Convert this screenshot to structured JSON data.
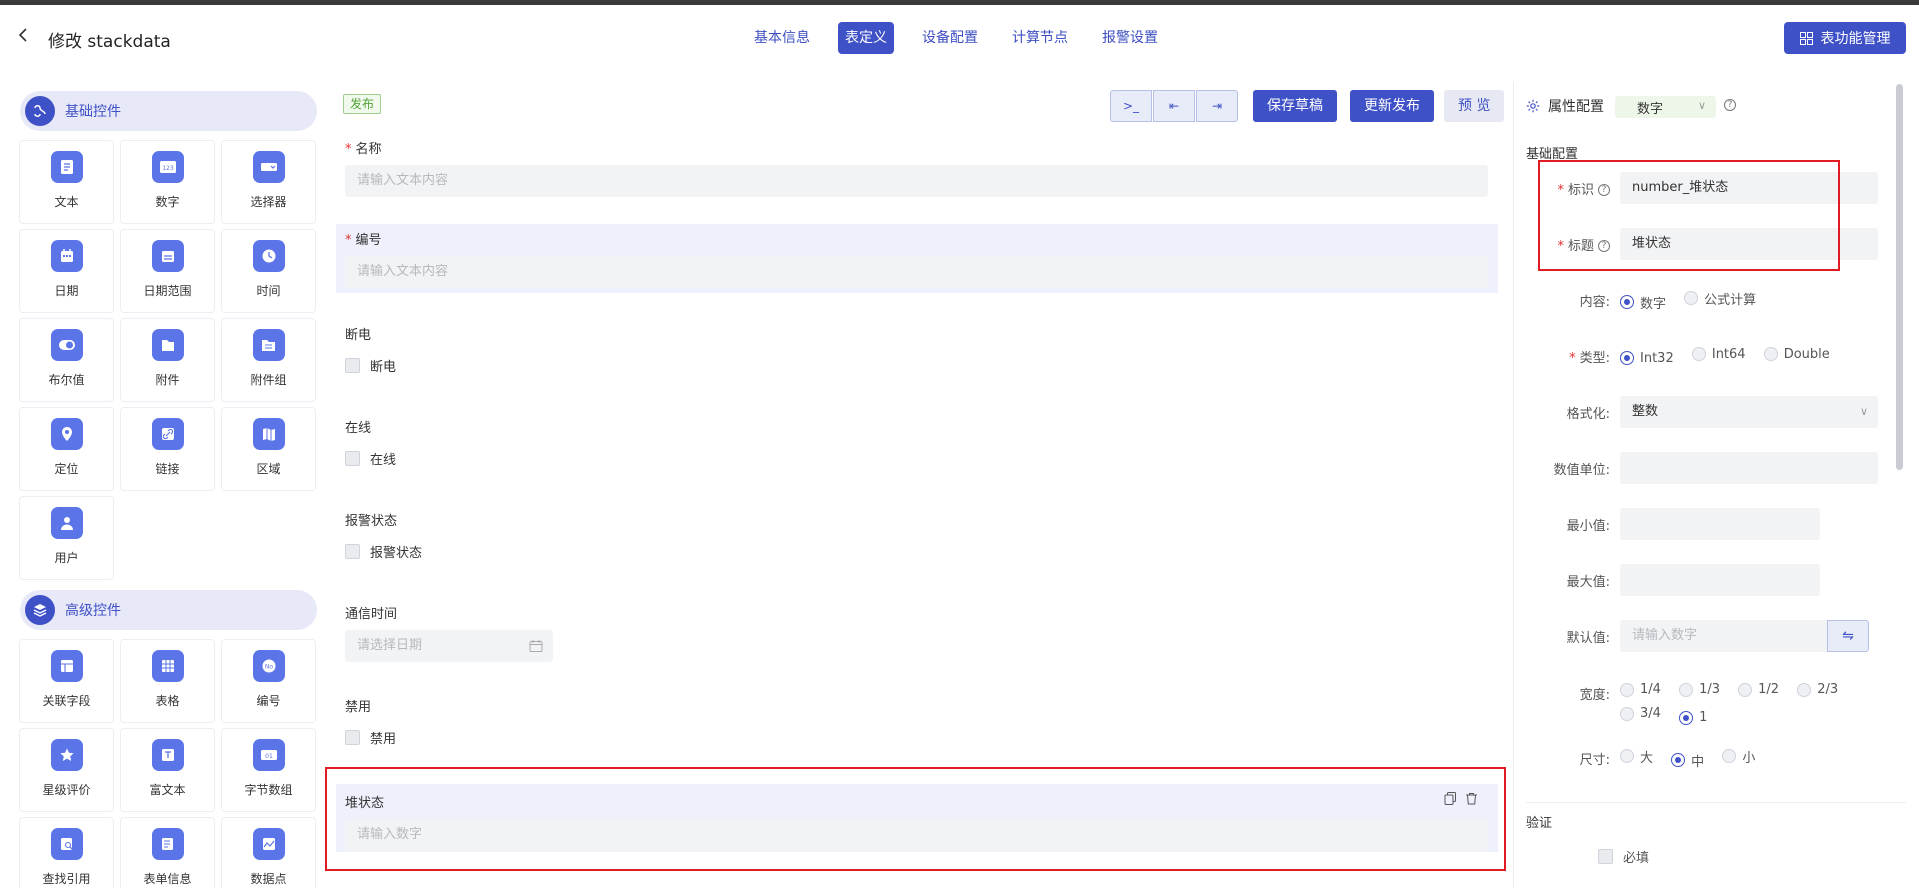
{
  "header": {
    "title": "修改 stackdata",
    "tabs": [
      {
        "label": "基本信息",
        "active": false
      },
      {
        "label": "表定义",
        "active": true
      },
      {
        "label": "设备配置",
        "active": false
      },
      {
        "label": "计算节点",
        "active": false
      },
      {
        "label": "报警设置",
        "active": false
      }
    ],
    "manage_button": "表功能管理"
  },
  "sidebar": {
    "basic_title": "基础控件",
    "basic_items": [
      {
        "label": "文本",
        "icon": "text-icon"
      },
      {
        "label": "数字",
        "icon": "number-icon"
      },
      {
        "label": "选择器",
        "icon": "select-icon"
      },
      {
        "label": "日期",
        "icon": "date-icon"
      },
      {
        "label": "日期范围",
        "icon": "date-range-icon"
      },
      {
        "label": "时间",
        "icon": "time-icon"
      },
      {
        "label": "布尔值",
        "icon": "boolean-icon"
      },
      {
        "label": "附件",
        "icon": "attachment-icon"
      },
      {
        "label": "附件组",
        "icon": "attachment-group-icon"
      },
      {
        "label": "定位",
        "icon": "location-icon"
      },
      {
        "label": "链接",
        "icon": "link-icon"
      },
      {
        "label": "区域",
        "icon": "area-icon"
      },
      {
        "label": "用户",
        "icon": "user-icon"
      }
    ],
    "advanced_title": "高级控件",
    "advanced_items": [
      {
        "label": "关联字段",
        "icon": "relation-field-icon"
      },
      {
        "label": "表格",
        "icon": "table-icon"
      },
      {
        "label": "编号",
        "icon": "serial-number-icon"
      },
      {
        "label": "星级评价",
        "icon": "star-rating-icon"
      },
      {
        "label": "富文本",
        "icon": "rich-text-icon"
      },
      {
        "label": "字节数组",
        "icon": "byte-array-icon"
      },
      {
        "label": "查找引用",
        "icon": "lookup-icon"
      },
      {
        "label": "表单信息",
        "icon": "form-info-icon"
      },
      {
        "label": "数据点",
        "icon": "data-point-icon"
      }
    ]
  },
  "form": {
    "status_badge": "发布",
    "toolbar_icons": [
      ">_",
      "⇤",
      "⇥"
    ],
    "save_draft": "保存草稿",
    "update_publish": "更新发布",
    "preview": "预 览",
    "name_label": "名称",
    "name_placeholder": "请输入文本内容",
    "code_label": "编号",
    "code_placeholder": "请输入文本内容",
    "power_label": "断电",
    "power_checkbox": "断电",
    "online_label": "在线",
    "online_checkbox": "在线",
    "alarm_label": "报警状态",
    "alarm_checkbox": "报警状态",
    "comm_time_label": "通信时间",
    "comm_time_placeholder": "请选择日期",
    "disabled_label": "禁用",
    "disabled_checkbox": "禁用",
    "stack_label": "堆状态",
    "stack_placeholder": "请输入数字"
  },
  "properties": {
    "title": "属性配置",
    "type_value": "数字",
    "basic_config": "基础配置",
    "id_label": "标识",
    "id_value": "number_堆状态",
    "title_label": "标题",
    "title_value": "堆状态",
    "content_label": "内容:",
    "content_options": [
      "数字",
      "公式计算"
    ],
    "type_label": "类型:",
    "type_options": [
      "Int32",
      "Int64",
      "Double"
    ],
    "format_label": "格式化:",
    "format_value": "整数",
    "unit_label": "数值单位:",
    "min_label": "最小值:",
    "max_label": "最大值:",
    "default_label": "默认值:",
    "default_placeholder": "请输入数字",
    "width_label": "宽度:",
    "width_options": [
      "1/4",
      "1/3",
      "1/2",
      "2/3",
      "3/4",
      "1"
    ],
    "size_label": "尺寸:",
    "size_options": [
      "大",
      "中",
      "小"
    ],
    "validation_title": "验证",
    "required_label": "必填"
  },
  "colors": {
    "primary": "#3f51c6",
    "highlight": "#e01b24"
  }
}
